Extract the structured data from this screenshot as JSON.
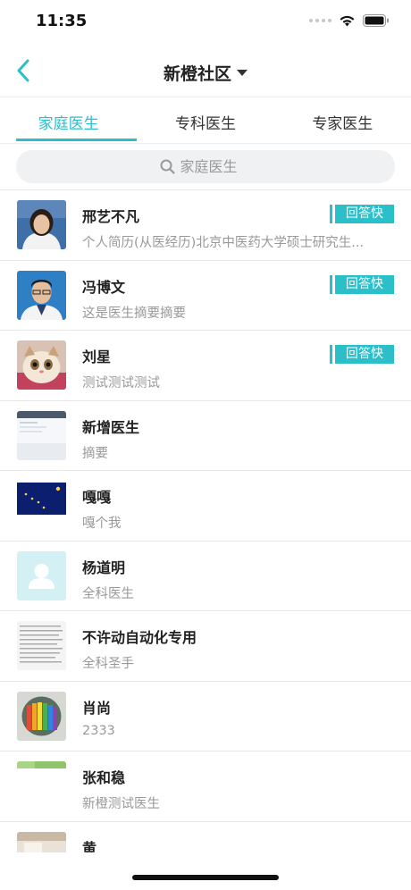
{
  "status": {
    "time": "11:35"
  },
  "nav": {
    "title": "新橙社区"
  },
  "tabs": [
    {
      "label": "家庭医生",
      "active": true
    },
    {
      "label": "专科医生",
      "active": false
    },
    {
      "label": "专家医生",
      "active": false
    }
  ],
  "search": {
    "placeholder": "家庭医生"
  },
  "doctors": [
    {
      "name": "邢艺不凡",
      "desc": "个人简历(从医经历)北京中医药大学硕士研究生...",
      "badge": "回答快",
      "avatar": "doctor-woman-photo"
    },
    {
      "name": "冯博文",
      "desc": "这是医生摘要摘要",
      "badge": "回答快",
      "avatar": "doctor-man-photo"
    },
    {
      "name": "刘星",
      "desc": "测试测试测试",
      "badge": "回答快",
      "avatar": "cat-photo"
    },
    {
      "name": "新增医生",
      "desc": "摘要",
      "badge": "",
      "avatar": "screenshot-thumbnail"
    },
    {
      "name": "嘎嘎",
      "desc": "嘎个我",
      "badge": "",
      "avatar": "flag-image"
    },
    {
      "name": "杨道明",
      "desc": "全科医生",
      "badge": "",
      "avatar": "default-person-icon"
    },
    {
      "name": "不许动自动化专用",
      "desc": "全科圣手",
      "badge": "",
      "avatar": "text-document-thumbnail"
    },
    {
      "name": "肖尚",
      "desc": "2333",
      "badge": "",
      "avatar": "pencils-photo"
    },
    {
      "name": "张和稳",
      "desc": "新橙测试医生",
      "badge": "",
      "avatar": "green-landscape-photo"
    },
    {
      "name": "黄",
      "desc": "",
      "badge": "",
      "avatar": "room-photo"
    }
  ],
  "colors": {
    "accent": "#2bbfc9"
  }
}
